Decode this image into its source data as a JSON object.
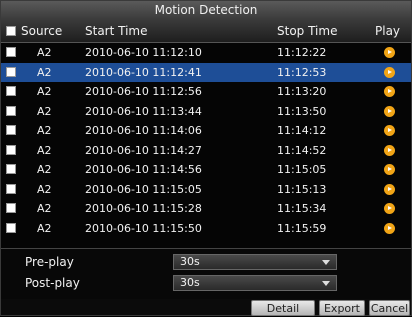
{
  "title": "Motion Detection",
  "header": {
    "source": "Source",
    "start_time": "Start Time",
    "stop_time": "Stop Time",
    "play": "Play"
  },
  "rows": [
    {
      "source": "A2",
      "start": "2010-06-10 11:12:10",
      "stop": "11:12:22",
      "selected": false
    },
    {
      "source": "A2",
      "start": "2010-06-10 11:12:41",
      "stop": "11:12:53",
      "selected": true
    },
    {
      "source": "A2",
      "start": "2010-06-10 11:12:56",
      "stop": "11:13:20",
      "selected": false
    },
    {
      "source": "A2",
      "start": "2010-06-10 11:13:44",
      "stop": "11:13:50",
      "selected": false
    },
    {
      "source": "A2",
      "start": "2010-06-10 11:14:06",
      "stop": "11:14:12",
      "selected": false
    },
    {
      "source": "A2",
      "start": "2010-06-10 11:14:27",
      "stop": "11:14:52",
      "selected": false
    },
    {
      "source": "A2",
      "start": "2010-06-10 11:14:56",
      "stop": "11:15:05",
      "selected": false
    },
    {
      "source": "A2",
      "start": "2010-06-10 11:15:05",
      "stop": "11:15:13",
      "selected": false
    },
    {
      "source": "A2",
      "start": "2010-06-10 11:15:28",
      "stop": "11:15:34",
      "selected": false
    },
    {
      "source": "A2",
      "start": "2010-06-10 11:15:50",
      "stop": "11:15:59",
      "selected": false
    }
  ],
  "pre_play": {
    "label": "Pre-play",
    "value": "30s"
  },
  "post_play": {
    "label": "Post-play",
    "value": "30s"
  },
  "buttons": {
    "detail": "Detail",
    "export": "Export",
    "cancel": "Cancel"
  },
  "colors": {
    "selected_row": "#1e4e97",
    "play_icon": "#f2a516"
  },
  "icons": {
    "play": "play-circle-icon",
    "dropdown": "chevron-down-icon"
  }
}
